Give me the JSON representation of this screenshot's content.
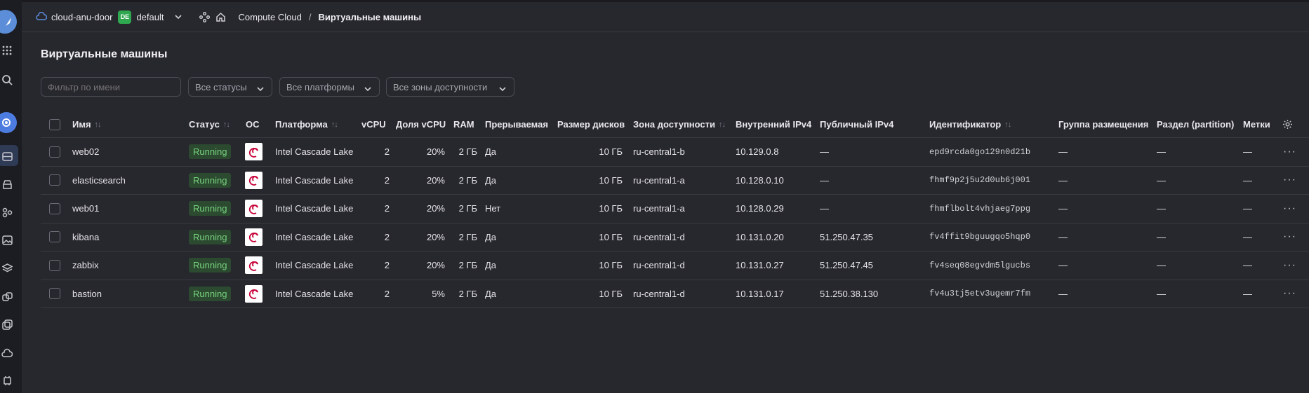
{
  "header": {
    "cloud_name": "cloud-anu-door",
    "folder_badge": "DE",
    "folder_name": "default",
    "breadcrumb_service": "Compute Cloud",
    "breadcrumb_sep": "/",
    "breadcrumb_current": "Виртуальные машины"
  },
  "page": {
    "title": "Виртуальные машины"
  },
  "filters": {
    "name_placeholder": "Фильтр по имени",
    "status_select": "Все статусы",
    "platform_select": "Все платформы",
    "zone_select": "Все зоны доступности"
  },
  "columns": {
    "name": "Имя",
    "status": "Статус",
    "os": "ОС",
    "platform": "Платформа",
    "vcpu": "vCPU",
    "vcpu_share": "Доля vCPU",
    "ram": "RAM",
    "preemptible": "Прерываемая",
    "disk_size": "Размер дисков",
    "zone": "Зона доступности",
    "internal_ip": "Внутренний IPv4",
    "public_ip": "Публичный IPv4",
    "id": "Идентификатор",
    "placement_group": "Группа размещения",
    "partition": "Раздел (partition)",
    "labels": "Метки"
  },
  "sort_glyph": "↑↓",
  "rows": [
    {
      "name": "web02",
      "status": "Running",
      "platform": "Intel Cascade Lake",
      "vcpu": "2",
      "vcpu_share": "20%",
      "ram": "2 ГБ",
      "preemptible": "Да",
      "disk": "10 ГБ",
      "zone": "ru-central1-b",
      "internal_ip": "10.129.0.8",
      "public_ip": "—",
      "id": "epd9rcda0go129n0d21b",
      "placement_group": "—",
      "partition": "—",
      "labels": "—"
    },
    {
      "name": "elasticsearch",
      "status": "Running",
      "platform": "Intel Cascade Lake",
      "vcpu": "2",
      "vcpu_share": "20%",
      "ram": "2 ГБ",
      "preemptible": "Да",
      "disk": "10 ГБ",
      "zone": "ru-central1-a",
      "internal_ip": "10.128.0.10",
      "public_ip": "—",
      "id": "fhmf9p2j5u2d0ub6j001",
      "placement_group": "—",
      "partition": "—",
      "labels": "—"
    },
    {
      "name": "web01",
      "status": "Running",
      "platform": "Intel Cascade Lake",
      "vcpu": "2",
      "vcpu_share": "20%",
      "ram": "2 ГБ",
      "preemptible": "Нет",
      "disk": "10 ГБ",
      "zone": "ru-central1-a",
      "internal_ip": "10.128.0.29",
      "public_ip": "—",
      "id": "fhmflbolt4vhjaeg7ppg",
      "placement_group": "—",
      "partition": "—",
      "labels": "—"
    },
    {
      "name": "kibana",
      "status": "Running",
      "platform": "Intel Cascade Lake",
      "vcpu": "2",
      "vcpu_share": "20%",
      "ram": "2 ГБ",
      "preemptible": "Да",
      "disk": "10 ГБ",
      "zone": "ru-central1-d",
      "internal_ip": "10.131.0.20",
      "public_ip": "51.250.47.35",
      "id": "fv4ffit9bguugqo5hqp0",
      "placement_group": "—",
      "partition": "—",
      "labels": "—"
    },
    {
      "name": "zabbix",
      "status": "Running",
      "platform": "Intel Cascade Lake",
      "vcpu": "2",
      "vcpu_share": "20%",
      "ram": "2 ГБ",
      "preemptible": "Да",
      "disk": "10 ГБ",
      "zone": "ru-central1-d",
      "internal_ip": "10.131.0.27",
      "public_ip": "51.250.47.45",
      "id": "fv4seq08egvdm5lgucbs",
      "placement_group": "—",
      "partition": "—",
      "labels": "—"
    },
    {
      "name": "bastion",
      "status": "Running",
      "platform": "Intel Cascade Lake",
      "vcpu": "2",
      "vcpu_share": "5%",
      "ram": "2 ГБ",
      "preemptible": "Да",
      "disk": "10 ГБ",
      "zone": "ru-central1-d",
      "internal_ip": "10.131.0.17",
      "public_ip": "51.250.38.130",
      "id": "fv4u3tj5etv3ugemr7fm",
      "placement_group": "—",
      "partition": "—",
      "labels": "—"
    }
  ],
  "row_menu_glyph": "···",
  "colors": {
    "accent": "#4d7ce0",
    "status_running_bg": "#2c4a2f",
    "status_running_fg": "#77d480",
    "badge_green": "#2fa84f"
  },
  "os_icon": "debian-logo-icon"
}
